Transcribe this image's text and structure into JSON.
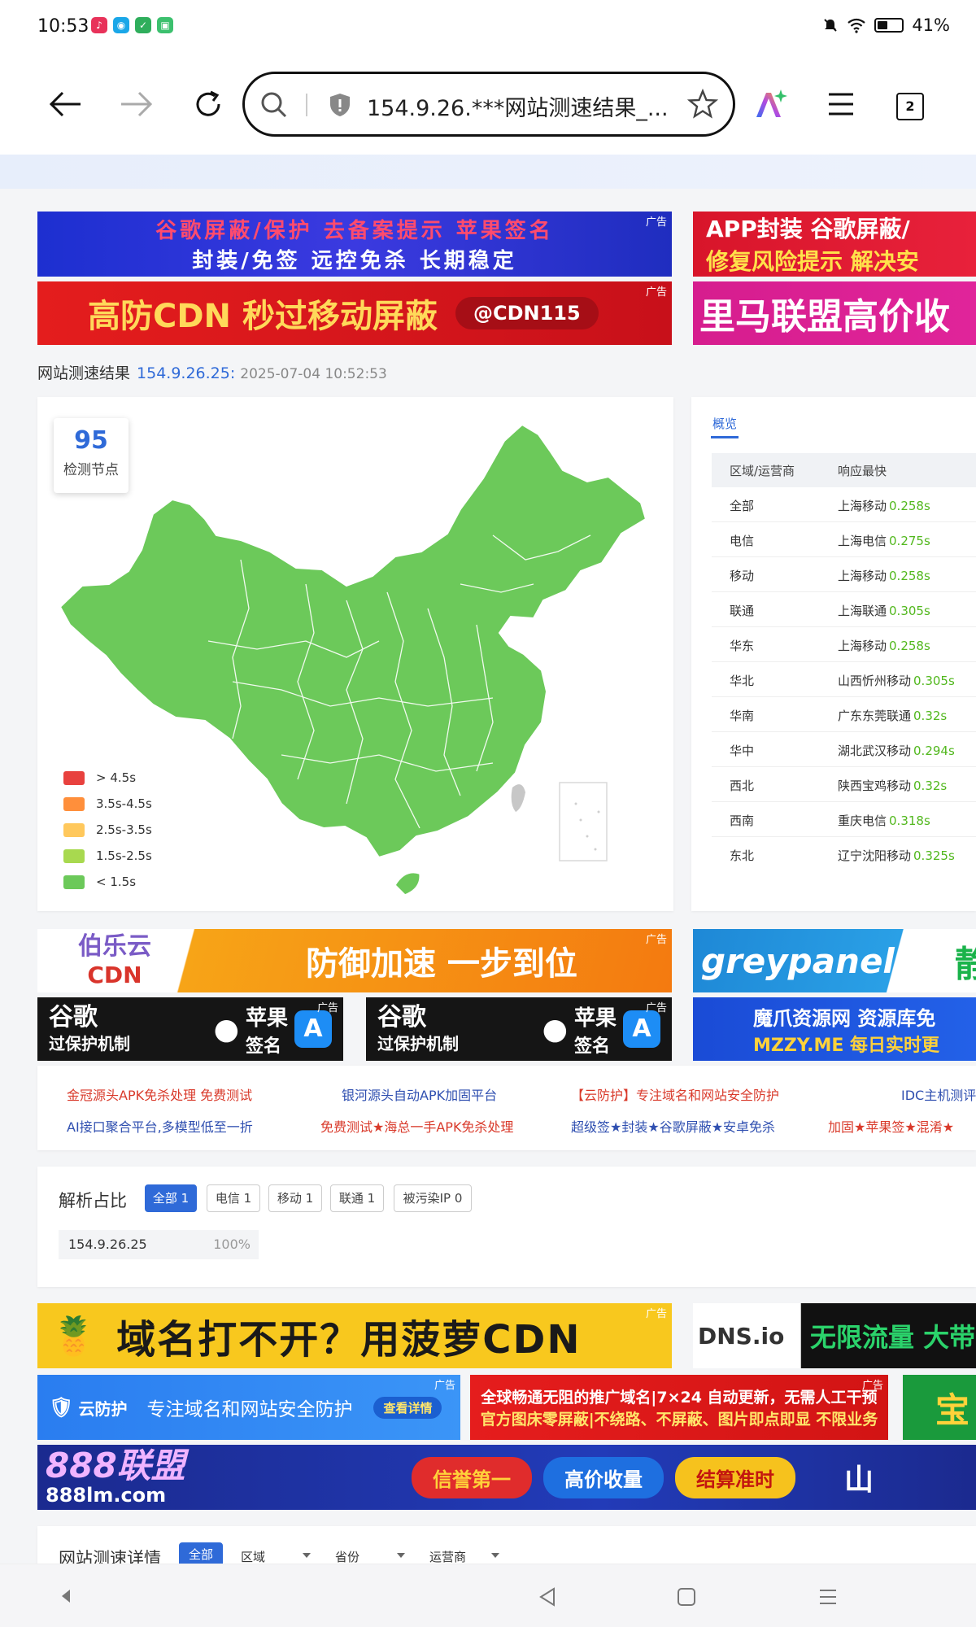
{
  "status_bar": {
    "time": "10:53",
    "battery": "41%"
  },
  "browser": {
    "url": "154.9.26.***网站测速结果_...",
    "tab_count": "2"
  },
  "ads": {
    "ad_label": "广告",
    "a1_line1": "谷歌屏蔽/保护  去备案提示  苹果签名",
    "a1_line2": "封装/免签  远控免杀  长期稳定",
    "a2_line1": "APP封装 谷歌屏蔽/",
    "a2_line2": "修复风险提示 解决安",
    "a3_text": "高防CDN 秒过移动屏蔽",
    "a3_tag": "@CDN115",
    "a4_text": "里马联盟高价收",
    "a5_brand": "伯乐云",
    "a5_brand2": "CDN",
    "a5_text": "防御加速 一步到位",
    "a6_text": "greypanel",
    "a6_side": "静",
    "a7_line1": "谷歌",
    "a7_line2": "过保护机制",
    "a7_apple": "苹果",
    "a7_apple2": "签名",
    "a8_line1": "魔爪资源网 资源库免",
    "a8_line2": "MZZY.ME 每日实时更",
    "a9_text": "域名打不开？用菠萝CDN",
    "a10_brand": "DNS.io",
    "a10_text": "无限流量 大带",
    "a11_brand": "云防护",
    "a11_text": "专注域名和网站安全防护",
    "a11_btn": "查看详情",
    "a12_line1": "全球畅通无阻的推广域名|7×24 自动更新，无需人工干预",
    "a12_line2": "官方图床零屏蔽|不绕路、不屏蔽、图片即点即显 不限业务",
    "a13_text": "宝",
    "a14_brand": "888联盟",
    "a14_domain": "888lm.com",
    "a14_b1": "信誉第一",
    "a14_b2": "高价收量",
    "a14_b3": "结算准时",
    "a14_side": "山"
  },
  "page": {
    "title": "网站测速结果",
    "ip": "154.9.26.25:",
    "datetime": "2025-07-04 10:52:53"
  },
  "map": {
    "node_count": "95",
    "node_label": "检测节点",
    "legend": [
      {
        "label": "> 4.5s",
        "color": "#e8413e"
      },
      {
        "label": "3.5s-4.5s",
        "color": "#ff8f3b"
      },
      {
        "label": "2.5s-3.5s",
        "color": "#ffc85c"
      },
      {
        "label": "1.5s-2.5s",
        "color": "#a8d94f"
      },
      {
        "label": "< 1.5s",
        "color": "#6cc95a"
      }
    ]
  },
  "overview": {
    "tab": "概览",
    "col1": "区域/运营商",
    "col2": "响应最快",
    "rows": [
      {
        "region": "全部",
        "node": "上海移动",
        "time": "0.258s"
      },
      {
        "region": "电信",
        "node": "上海电信",
        "time": "0.275s"
      },
      {
        "region": "移动",
        "node": "上海移动",
        "time": "0.258s"
      },
      {
        "region": "联通",
        "node": "上海联通",
        "time": "0.305s"
      },
      {
        "region": "华东",
        "node": "上海移动",
        "time": "0.258s"
      },
      {
        "region": "华北",
        "node": "山西忻州移动",
        "time": "0.305s"
      },
      {
        "region": "华南",
        "node": "广东东莞联通",
        "time": "0.32s"
      },
      {
        "region": "华中",
        "node": "湖北武汉移动",
        "time": "0.294s"
      },
      {
        "region": "西北",
        "node": "陕西宝鸡移动",
        "time": "0.32s"
      },
      {
        "region": "西南",
        "node": "重庆电信",
        "time": "0.318s"
      },
      {
        "region": "东北",
        "node": "辽宁沈阳移动",
        "time": "0.325s"
      }
    ]
  },
  "links": {
    "l1": "金冠源头APK免杀处理 免费测试",
    "l2": "银河源头自动APK加固平台",
    "l3": "【云防护】专注域名和网站安全防护",
    "l4": "IDC主机测评",
    "l5": "AI接口聚合平台,多模型低至一折",
    "l6": "免费测试★海总一手APK免杀处理",
    "l7": "超级签★封装★谷歌屏蔽★安卓免杀",
    "l8": "加固★苹果签★混淆★"
  },
  "resolution": {
    "title": "解析占比",
    "chips": [
      "全部 1",
      "电信 1",
      "移动 1",
      "联通 1",
      "被污染IP 0"
    ],
    "ip": "154.9.26.25",
    "percent": "100%"
  },
  "details": {
    "title": "网站测速详情",
    "all": "全部",
    "region": "区域",
    "province": "省份",
    "isp": "运营商"
  }
}
